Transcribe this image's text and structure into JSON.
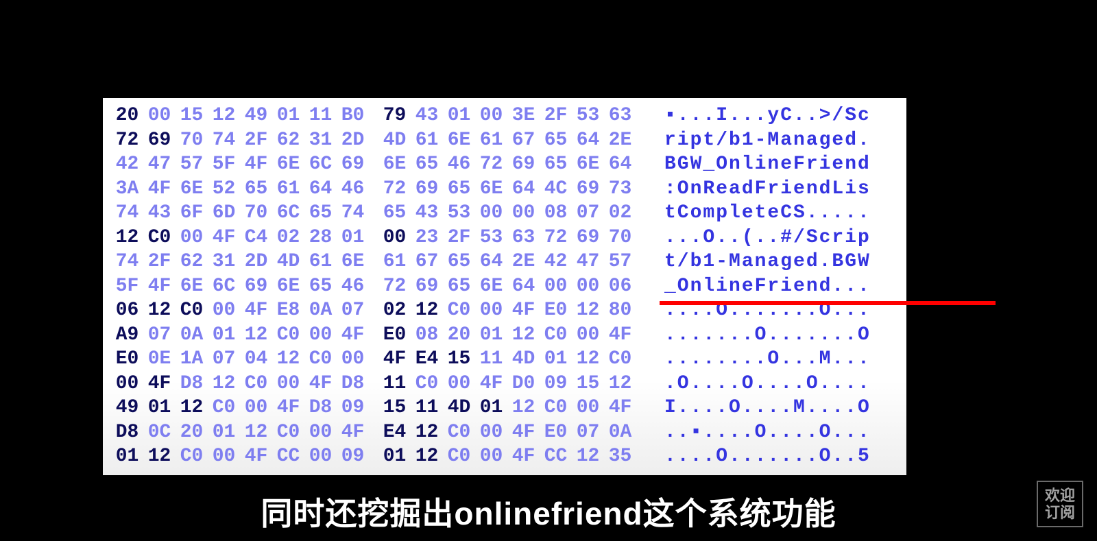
{
  "hex_rows": [
    {
      "cells": [
        {
          "v": "20",
          "s": "hi"
        },
        {
          "v": "00",
          "s": "lo"
        },
        {
          "v": "15",
          "s": "lo"
        },
        {
          "v": "12",
          "s": "lo"
        },
        {
          "v": "49",
          "s": "lo"
        },
        {
          "v": "01",
          "s": "lo"
        },
        {
          "v": "11",
          "s": "lo"
        },
        {
          "v": "B0",
          "s": "lo"
        },
        {
          "v": "79",
          "s": "hi"
        },
        {
          "v": "43",
          "s": "lo"
        },
        {
          "v": "01",
          "s": "lo"
        },
        {
          "v": "00",
          "s": "lo"
        },
        {
          "v": "3E",
          "s": "lo"
        },
        {
          "v": "2F",
          "s": "lo"
        },
        {
          "v": "53",
          "s": "lo"
        },
        {
          "v": "63",
          "s": "lo"
        }
      ],
      "ascii": "▪...I...yC..>/Sc"
    },
    {
      "cells": [
        {
          "v": "72",
          "s": "hi"
        },
        {
          "v": "69",
          "s": "hi"
        },
        {
          "v": "70",
          "s": "lo"
        },
        {
          "v": "74",
          "s": "lo"
        },
        {
          "v": "2F",
          "s": "lo"
        },
        {
          "v": "62",
          "s": "lo"
        },
        {
          "v": "31",
          "s": "lo"
        },
        {
          "v": "2D",
          "s": "lo"
        },
        {
          "v": "4D",
          "s": "lo"
        },
        {
          "v": "61",
          "s": "lo"
        },
        {
          "v": "6E",
          "s": "lo"
        },
        {
          "v": "61",
          "s": "lo"
        },
        {
          "v": "67",
          "s": "lo"
        },
        {
          "v": "65",
          "s": "lo"
        },
        {
          "v": "64",
          "s": "lo"
        },
        {
          "v": "2E",
          "s": "lo"
        }
      ],
      "ascii": "ript/b1-Managed."
    },
    {
      "cells": [
        {
          "v": "42",
          "s": "lo"
        },
        {
          "v": "47",
          "s": "lo"
        },
        {
          "v": "57",
          "s": "lo"
        },
        {
          "v": "5F",
          "s": "lo"
        },
        {
          "v": "4F",
          "s": "lo"
        },
        {
          "v": "6E",
          "s": "lo"
        },
        {
          "v": "6C",
          "s": "lo"
        },
        {
          "v": "69",
          "s": "lo"
        },
        {
          "v": "6E",
          "s": "lo"
        },
        {
          "v": "65",
          "s": "lo"
        },
        {
          "v": "46",
          "s": "lo"
        },
        {
          "v": "72",
          "s": "lo"
        },
        {
          "v": "69",
          "s": "lo"
        },
        {
          "v": "65",
          "s": "lo"
        },
        {
          "v": "6E",
          "s": "lo"
        },
        {
          "v": "64",
          "s": "lo"
        }
      ],
      "ascii": "BGW_OnlineFriend"
    },
    {
      "cells": [
        {
          "v": "3A",
          "s": "lo"
        },
        {
          "v": "4F",
          "s": "lo"
        },
        {
          "v": "6E",
          "s": "lo"
        },
        {
          "v": "52",
          "s": "lo"
        },
        {
          "v": "65",
          "s": "lo"
        },
        {
          "v": "61",
          "s": "lo"
        },
        {
          "v": "64",
          "s": "lo"
        },
        {
          "v": "46",
          "s": "lo"
        },
        {
          "v": "72",
          "s": "lo"
        },
        {
          "v": "69",
          "s": "lo"
        },
        {
          "v": "65",
          "s": "lo"
        },
        {
          "v": "6E",
          "s": "lo"
        },
        {
          "v": "64",
          "s": "lo"
        },
        {
          "v": "4C",
          "s": "lo"
        },
        {
          "v": "69",
          "s": "lo"
        },
        {
          "v": "73",
          "s": "lo"
        }
      ],
      "ascii": ":OnReadFriendLis"
    },
    {
      "cells": [
        {
          "v": "74",
          "s": "lo"
        },
        {
          "v": "43",
          "s": "lo"
        },
        {
          "v": "6F",
          "s": "lo"
        },
        {
          "v": "6D",
          "s": "lo"
        },
        {
          "v": "70",
          "s": "lo"
        },
        {
          "v": "6C",
          "s": "lo"
        },
        {
          "v": "65",
          "s": "lo"
        },
        {
          "v": "74",
          "s": "lo"
        },
        {
          "v": "65",
          "s": "lo"
        },
        {
          "v": "43",
          "s": "lo"
        },
        {
          "v": "53",
          "s": "lo"
        },
        {
          "v": "00",
          "s": "lo"
        },
        {
          "v": "00",
          "s": "lo"
        },
        {
          "v": "08",
          "s": "lo"
        },
        {
          "v": "07",
          "s": "lo"
        },
        {
          "v": "02",
          "s": "lo"
        }
      ],
      "ascii": "tCompleteCS....."
    },
    {
      "cells": [
        {
          "v": "12",
          "s": "hi"
        },
        {
          "v": "C0",
          "s": "hi"
        },
        {
          "v": "00",
          "s": "lo"
        },
        {
          "v": "4F",
          "s": "lo"
        },
        {
          "v": "C4",
          "s": "lo"
        },
        {
          "v": "02",
          "s": "lo"
        },
        {
          "v": "28",
          "s": "lo"
        },
        {
          "v": "01",
          "s": "lo"
        },
        {
          "v": "00",
          "s": "hi"
        },
        {
          "v": "23",
          "s": "lo"
        },
        {
          "v": "2F",
          "s": "lo"
        },
        {
          "v": "53",
          "s": "lo"
        },
        {
          "v": "63",
          "s": "lo"
        },
        {
          "v": "72",
          "s": "lo"
        },
        {
          "v": "69",
          "s": "lo"
        },
        {
          "v": "70",
          "s": "lo"
        }
      ],
      "ascii": "...O..(..#/Scrip"
    },
    {
      "cells": [
        {
          "v": "74",
          "s": "lo"
        },
        {
          "v": "2F",
          "s": "lo"
        },
        {
          "v": "62",
          "s": "lo"
        },
        {
          "v": "31",
          "s": "lo"
        },
        {
          "v": "2D",
          "s": "lo"
        },
        {
          "v": "4D",
          "s": "lo"
        },
        {
          "v": "61",
          "s": "lo"
        },
        {
          "v": "6E",
          "s": "lo"
        },
        {
          "v": "61",
          "s": "lo"
        },
        {
          "v": "67",
          "s": "lo"
        },
        {
          "v": "65",
          "s": "lo"
        },
        {
          "v": "64",
          "s": "lo"
        },
        {
          "v": "2E",
          "s": "lo"
        },
        {
          "v": "42",
          "s": "lo"
        },
        {
          "v": "47",
          "s": "lo"
        },
        {
          "v": "57",
          "s": "lo"
        }
      ],
      "ascii": "t/b1-Managed.BGW"
    },
    {
      "cells": [
        {
          "v": "5F",
          "s": "lo"
        },
        {
          "v": "4F",
          "s": "lo"
        },
        {
          "v": "6E",
          "s": "lo"
        },
        {
          "v": "6C",
          "s": "lo"
        },
        {
          "v": "69",
          "s": "lo"
        },
        {
          "v": "6E",
          "s": "lo"
        },
        {
          "v": "65",
          "s": "lo"
        },
        {
          "v": "46",
          "s": "lo"
        },
        {
          "v": "72",
          "s": "lo"
        },
        {
          "v": "69",
          "s": "lo"
        },
        {
          "v": "65",
          "s": "lo"
        },
        {
          "v": "6E",
          "s": "lo"
        },
        {
          "v": "64",
          "s": "lo"
        },
        {
          "v": "00",
          "s": "lo"
        },
        {
          "v": "00",
          "s": "lo"
        },
        {
          "v": "06",
          "s": "lo"
        }
      ],
      "ascii": "_OnlineFriend..."
    },
    {
      "cells": [
        {
          "v": "06",
          "s": "hi"
        },
        {
          "v": "12",
          "s": "hi"
        },
        {
          "v": "C0",
          "s": "hi"
        },
        {
          "v": "00",
          "s": "lo"
        },
        {
          "v": "4F",
          "s": "lo"
        },
        {
          "v": "E8",
          "s": "lo"
        },
        {
          "v": "0A",
          "s": "lo"
        },
        {
          "v": "07",
          "s": "lo"
        },
        {
          "v": "02",
          "s": "hi"
        },
        {
          "v": "12",
          "s": "hi"
        },
        {
          "v": "C0",
          "s": "lo"
        },
        {
          "v": "00",
          "s": "lo"
        },
        {
          "v": "4F",
          "s": "lo"
        },
        {
          "v": "E0",
          "s": "lo"
        },
        {
          "v": "12",
          "s": "lo"
        },
        {
          "v": "80",
          "s": "lo"
        }
      ],
      "ascii": "....O.......O..."
    },
    {
      "cells": [
        {
          "v": "A9",
          "s": "hi"
        },
        {
          "v": "07",
          "s": "lo"
        },
        {
          "v": "0A",
          "s": "lo"
        },
        {
          "v": "01",
          "s": "lo"
        },
        {
          "v": "12",
          "s": "lo"
        },
        {
          "v": "C0",
          "s": "lo"
        },
        {
          "v": "00",
          "s": "lo"
        },
        {
          "v": "4F",
          "s": "lo"
        },
        {
          "v": "E0",
          "s": "hi"
        },
        {
          "v": "08",
          "s": "lo"
        },
        {
          "v": "20",
          "s": "lo"
        },
        {
          "v": "01",
          "s": "lo"
        },
        {
          "v": "12",
          "s": "lo"
        },
        {
          "v": "C0",
          "s": "lo"
        },
        {
          "v": "00",
          "s": "lo"
        },
        {
          "v": "4F",
          "s": "lo"
        }
      ],
      "ascii": ".......O.......O"
    },
    {
      "cells": [
        {
          "v": "E0",
          "s": "hi"
        },
        {
          "v": "0E",
          "s": "lo"
        },
        {
          "v": "1A",
          "s": "lo"
        },
        {
          "v": "07",
          "s": "lo"
        },
        {
          "v": "04",
          "s": "lo"
        },
        {
          "v": "12",
          "s": "lo"
        },
        {
          "v": "C0",
          "s": "lo"
        },
        {
          "v": "00",
          "s": "lo"
        },
        {
          "v": "4F",
          "s": "hi"
        },
        {
          "v": "E4",
          "s": "hi"
        },
        {
          "v": "15",
          "s": "hi"
        },
        {
          "v": "11",
          "s": "lo"
        },
        {
          "v": "4D",
          "s": "lo"
        },
        {
          "v": "01",
          "s": "lo"
        },
        {
          "v": "12",
          "s": "lo"
        },
        {
          "v": "C0",
          "s": "lo"
        }
      ],
      "ascii": "........O...M..."
    },
    {
      "cells": [
        {
          "v": "00",
          "s": "hi"
        },
        {
          "v": "4F",
          "s": "hi"
        },
        {
          "v": "D8",
          "s": "lo"
        },
        {
          "v": "12",
          "s": "lo"
        },
        {
          "v": "C0",
          "s": "lo"
        },
        {
          "v": "00",
          "s": "lo"
        },
        {
          "v": "4F",
          "s": "lo"
        },
        {
          "v": "D8",
          "s": "lo"
        },
        {
          "v": "11",
          "s": "hi"
        },
        {
          "v": "C0",
          "s": "lo"
        },
        {
          "v": "00",
          "s": "lo"
        },
        {
          "v": "4F",
          "s": "lo"
        },
        {
          "v": "D0",
          "s": "lo"
        },
        {
          "v": "09",
          "s": "lo"
        },
        {
          "v": "15",
          "s": "lo"
        },
        {
          "v": "12",
          "s": "lo"
        }
      ],
      "ascii": ".O....O....O...."
    },
    {
      "cells": [
        {
          "v": "49",
          "s": "hi"
        },
        {
          "v": "01",
          "s": "hi"
        },
        {
          "v": "12",
          "s": "hi"
        },
        {
          "v": "C0",
          "s": "lo"
        },
        {
          "v": "00",
          "s": "lo"
        },
        {
          "v": "4F",
          "s": "lo"
        },
        {
          "v": "D8",
          "s": "lo"
        },
        {
          "v": "09",
          "s": "lo"
        },
        {
          "v": "15",
          "s": "hi"
        },
        {
          "v": "11",
          "s": "hi"
        },
        {
          "v": "4D",
          "s": "hi"
        },
        {
          "v": "01",
          "s": "hi"
        },
        {
          "v": "12",
          "s": "lo"
        },
        {
          "v": "C0",
          "s": "lo"
        },
        {
          "v": "00",
          "s": "lo"
        },
        {
          "v": "4F",
          "s": "lo"
        }
      ],
      "ascii": "I....O....M....O"
    },
    {
      "cells": [
        {
          "v": "D8",
          "s": "hi"
        },
        {
          "v": "0C",
          "s": "lo"
        },
        {
          "v": "20",
          "s": "lo"
        },
        {
          "v": "01",
          "s": "lo"
        },
        {
          "v": "12",
          "s": "lo"
        },
        {
          "v": "C0",
          "s": "lo"
        },
        {
          "v": "00",
          "s": "lo"
        },
        {
          "v": "4F",
          "s": "lo"
        },
        {
          "v": "E4",
          "s": "hi"
        },
        {
          "v": "12",
          "s": "hi"
        },
        {
          "v": "C0",
          "s": "lo"
        },
        {
          "v": "00",
          "s": "lo"
        },
        {
          "v": "4F",
          "s": "lo"
        },
        {
          "v": "E0",
          "s": "lo"
        },
        {
          "v": "07",
          "s": "lo"
        },
        {
          "v": "0A",
          "s": "lo"
        }
      ],
      "ascii": "..▪....O....O..."
    },
    {
      "cells": [
        {
          "v": "01",
          "s": "hi"
        },
        {
          "v": "12",
          "s": "hi"
        },
        {
          "v": "C0",
          "s": "lo"
        },
        {
          "v": "00",
          "s": "lo"
        },
        {
          "v": "4F",
          "s": "lo"
        },
        {
          "v": "CC",
          "s": "lo"
        },
        {
          "v": "00",
          "s": "lo"
        },
        {
          "v": "09",
          "s": "lo"
        },
        {
          "v": "01",
          "s": "hi"
        },
        {
          "v": "12",
          "s": "hi"
        },
        {
          "v": "C0",
          "s": "lo"
        },
        {
          "v": "00",
          "s": "lo"
        },
        {
          "v": "4F",
          "s": "lo"
        },
        {
          "v": "CC",
          "s": "lo"
        },
        {
          "v": "12",
          "s": "lo"
        },
        {
          "v": "35",
          "s": "lo"
        }
      ],
      "ascii": "....O.......O..5"
    }
  ],
  "subtitle": "同时还挖掘出onlinefriend这个系统功能",
  "watermark": {
    "line1": "欢迎",
    "line2": "订阅"
  }
}
